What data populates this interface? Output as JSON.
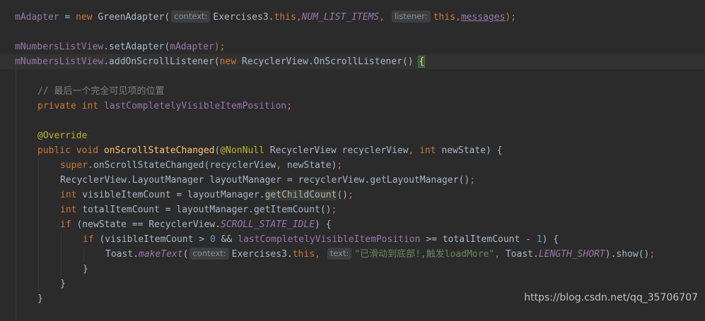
{
  "editor": {
    "background": "#2b2b2b",
    "current_line_background": "#323232",
    "lines": [
      {
        "segs": [
          {
            "t": "mAdapter",
            "c": "field"
          },
          {
            "t": " = ",
            "c": "plain"
          },
          {
            "t": "new",
            "c": "kw"
          },
          {
            "t": " GreenAdapter(",
            "c": "plain"
          },
          {
            "t": "context:",
            "c": "hint"
          },
          {
            "t": "Exercises3.",
            "c": "plain"
          },
          {
            "t": "this",
            "c": "kw"
          },
          {
            "t": ",",
            "c": "kw"
          },
          {
            "t": "NUM_LIST_ITEMS",
            "c": "static"
          },
          {
            "t": ",",
            "c": "kw"
          },
          {
            "t": " ",
            "c": "plain"
          },
          {
            "t": "listener:",
            "c": "hint"
          },
          {
            "t": "this",
            "c": "kw"
          },
          {
            "t": ",",
            "c": "kw"
          },
          {
            "t": "messages",
            "c": "field ul"
          },
          {
            "t": ");",
            "c": "kw"
          }
        ]
      },
      {
        "segs": []
      },
      {
        "segs": [
          {
            "t": "mNumbersListView",
            "c": "field"
          },
          {
            "t": ".setAdapter(",
            "c": "plain"
          },
          {
            "t": "mAdapter",
            "c": "field"
          },
          {
            "t": ");",
            "c": "kw"
          }
        ]
      },
      {
        "current": true,
        "segs": [
          {
            "t": "mNumbersListView",
            "c": "field"
          },
          {
            "t": ".addOnScrollListener(",
            "c": "plain"
          },
          {
            "t": "new",
            "c": "kw"
          },
          {
            "t": " RecyclerView.OnScrollListener() ",
            "c": "plain"
          },
          {
            "t": "{",
            "c": "brace"
          }
        ]
      },
      {
        "segs": []
      },
      {
        "indent": 1,
        "segs": [
          {
            "t": "// 最后一个完全可见项的位置",
            "c": "comment"
          }
        ]
      },
      {
        "indent": 1,
        "segs": [
          {
            "t": "private",
            "c": "kw"
          },
          {
            "t": " ",
            "c": "plain"
          },
          {
            "t": "int",
            "c": "kw"
          },
          {
            "t": " ",
            "c": "plain"
          },
          {
            "t": "lastCompletelyVisibleItemPosition",
            "c": "field"
          },
          {
            "t": ";",
            "c": "kw"
          }
        ]
      },
      {
        "segs": []
      },
      {
        "indent": 1,
        "segs": [
          {
            "t": "@Override",
            "c": "ann"
          }
        ]
      },
      {
        "indent": 1,
        "segs": [
          {
            "t": "public",
            "c": "kw"
          },
          {
            "t": " ",
            "c": "plain"
          },
          {
            "t": "void",
            "c": "kw"
          },
          {
            "t": " ",
            "c": "plain"
          },
          {
            "t": "onScrollStateChanged",
            "c": "method"
          },
          {
            "t": "(",
            "c": "plain"
          },
          {
            "t": "@NonNull",
            "c": "ann"
          },
          {
            "t": " RecyclerView recyclerView",
            "c": "plain"
          },
          {
            "t": ",",
            "c": "kw"
          },
          {
            "t": " ",
            "c": "plain"
          },
          {
            "t": "int",
            "c": "kw"
          },
          {
            "t": " newState) {",
            "c": "plain"
          }
        ]
      },
      {
        "indent": 2,
        "segs": [
          {
            "t": "super",
            "c": "kw"
          },
          {
            "t": ".onScrollStateChanged(recyclerView",
            "c": "plain"
          },
          {
            "t": ",",
            "c": "kw"
          },
          {
            "t": " newState)",
            "c": "plain"
          },
          {
            "t": ";",
            "c": "kw"
          }
        ]
      },
      {
        "indent": 2,
        "segs": [
          {
            "t": "RecyclerView.LayoutManager layoutManager = recyclerView.getLayoutManager()",
            "c": "plain"
          },
          {
            "t": ";",
            "c": "kw"
          }
        ]
      },
      {
        "indent": 2,
        "segs": [
          {
            "t": "int",
            "c": "kw"
          },
          {
            "t": " visibleItemCount = layoutManager.",
            "c": "plain"
          },
          {
            "t": "getChildCount",
            "c": "hl"
          },
          {
            "t": "()",
            "c": "plain"
          },
          {
            "t": ";",
            "c": "kw"
          }
        ]
      },
      {
        "indent": 2,
        "segs": [
          {
            "t": "int",
            "c": "kw"
          },
          {
            "t": " totalItemCount = layoutManager.getItemCount()",
            "c": "plain"
          },
          {
            "t": ";",
            "c": "kw"
          }
        ]
      },
      {
        "indent": 2,
        "segs": [
          {
            "t": "if",
            "c": "kw"
          },
          {
            "t": " (newState == RecyclerView.",
            "c": "plain"
          },
          {
            "t": "SCROLL_STATE_IDLE",
            "c": "static"
          },
          {
            "t": ") {",
            "c": "plain"
          }
        ]
      },
      {
        "indent": 3,
        "segs": [
          {
            "t": "if",
            "c": "kw"
          },
          {
            "t": " (visibleItemCount > ",
            "c": "plain"
          },
          {
            "t": "0",
            "c": "num"
          },
          {
            "t": " && ",
            "c": "plain"
          },
          {
            "t": "lastCompletelyVisibleItemPosition",
            "c": "field"
          },
          {
            "t": " >= totalItemCount - ",
            "c": "plain"
          },
          {
            "t": "1",
            "c": "num"
          },
          {
            "t": ") {",
            "c": "plain"
          }
        ]
      },
      {
        "indent": 4,
        "segs": [
          {
            "t": "Toast.",
            "c": "plain"
          },
          {
            "t": "makeText",
            "c": "static"
          },
          {
            "t": "(",
            "c": "plain"
          },
          {
            "t": "context:",
            "c": "hint"
          },
          {
            "t": "Exercises3.",
            "c": "plain"
          },
          {
            "t": "this",
            "c": "kw"
          },
          {
            "t": ",",
            "c": "kw"
          },
          {
            "t": " ",
            "c": "plain"
          },
          {
            "t": "text:",
            "c": "hint"
          },
          {
            "t": "\"已滑动到底部!,触发loadMore\"",
            "c": "str"
          },
          {
            "t": ",",
            "c": "kw"
          },
          {
            "t": " Toast.",
            "c": "plain"
          },
          {
            "t": "LENGTH_SHORT",
            "c": "static"
          },
          {
            "t": ").show()",
            "c": "plain"
          },
          {
            "t": ";",
            "c": "kw"
          }
        ]
      },
      {
        "indent": 3,
        "segs": [
          {
            "t": "}",
            "c": "plain"
          }
        ]
      },
      {
        "indent": 2,
        "segs": [
          {
            "t": "}",
            "c": "plain"
          }
        ]
      },
      {
        "indent": 1,
        "segs": [
          {
            "t": "}",
            "c": "plain"
          }
        ]
      }
    ]
  },
  "watermark": "https://blog.csdn.net/qq_35706707"
}
